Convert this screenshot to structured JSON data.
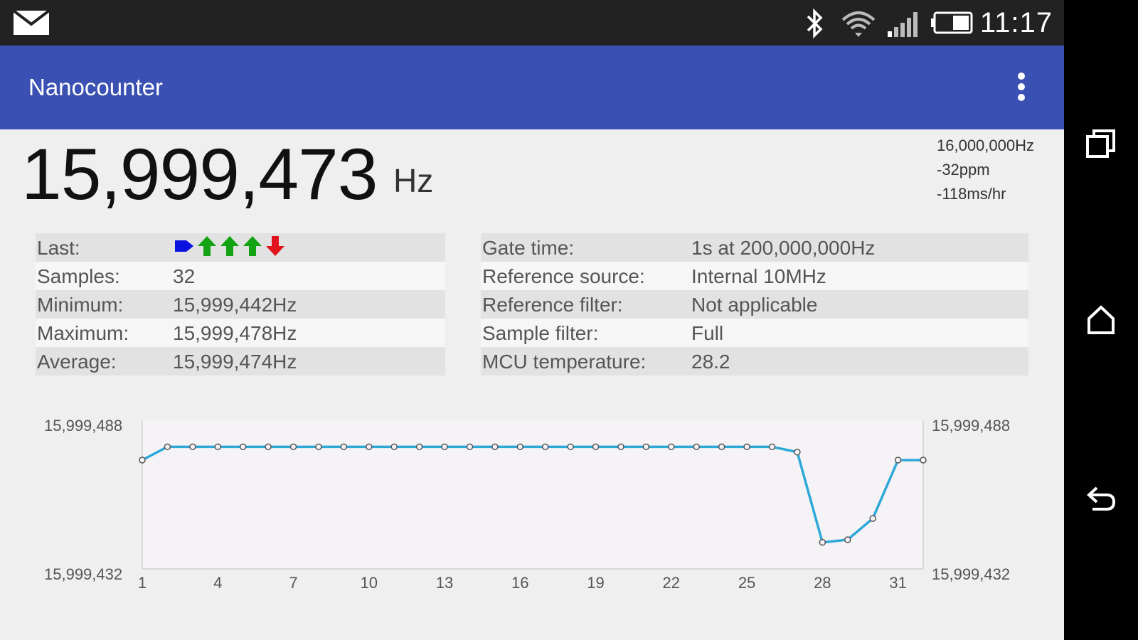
{
  "statusbar": {
    "time": "11:17",
    "notification_icon": "mail-icon",
    "icons": [
      "bluetooth-icon",
      "wifi-icon",
      "signal-icon",
      "battery-icon"
    ]
  },
  "appbar": {
    "title": "Nanocounter",
    "menu_icon": "overflow-menu-icon"
  },
  "reading": {
    "value": "15,999,473",
    "unit": "Hz"
  },
  "reference": {
    "nominal": "16,000,000Hz",
    "ppm": "-32ppm",
    "drift": "-118ms/hr"
  },
  "stats": {
    "last_label": "Last:",
    "last_indicators": [
      "right",
      "up",
      "up",
      "up",
      "down"
    ],
    "indicator_colors": {
      "right": "#0a12e0",
      "up": "#14a314",
      "down": "#e0141c"
    },
    "rows": [
      {
        "label": "Samples:",
        "value": "32"
      },
      {
        "label": "Minimum:",
        "value": "15,999,442Hz"
      },
      {
        "label": "Maximum:",
        "value": "15,999,478Hz"
      },
      {
        "label": "Average:",
        "value": "15,999,474Hz"
      }
    ]
  },
  "settings": {
    "rows": [
      {
        "label": "Gate time:",
        "value": "1s at 200,000,000Hz"
      },
      {
        "label": "Reference source:",
        "value": "Internal 10MHz"
      },
      {
        "label": "Reference filter:",
        "value": "Not applicable"
      },
      {
        "label": "Sample filter:",
        "value": "Full"
      },
      {
        "label": "MCU temperature:",
        "value": "28.2"
      }
    ]
  },
  "chart_data": {
    "type": "line",
    "y_left_labels": {
      "top": "15,999,488",
      "bottom": "15,999,432"
    },
    "y_right_labels": {
      "top": "15,999,488",
      "bottom": "15,999,432"
    },
    "ylim": [
      15999432,
      15999488
    ],
    "xlim": [
      1,
      32
    ],
    "x_tick_labels": [
      "1",
      "4",
      "7",
      "10",
      "13",
      "16",
      "19",
      "22",
      "25",
      "28",
      "31"
    ],
    "series_color": "#2ea8d8",
    "x": [
      1,
      2,
      3,
      4,
      5,
      6,
      7,
      8,
      9,
      10,
      11,
      12,
      13,
      14,
      15,
      16,
      17,
      18,
      19,
      20,
      21,
      22,
      23,
      24,
      25,
      26,
      27,
      28,
      29,
      30,
      31,
      32
    ],
    "y": [
      15999473,
      15999478,
      15999478,
      15999478,
      15999478,
      15999478,
      15999478,
      15999478,
      15999478,
      15999478,
      15999478,
      15999478,
      15999478,
      15999478,
      15999478,
      15999478,
      15999478,
      15999478,
      15999478,
      15999478,
      15999478,
      15999478,
      15999478,
      15999478,
      15999478,
      15999478,
      15999476,
      15999442,
      15999443,
      15999451,
      15999473,
      15999473
    ]
  },
  "navbar": {
    "icons": [
      "recent-apps-icon",
      "home-icon",
      "back-icon"
    ]
  }
}
